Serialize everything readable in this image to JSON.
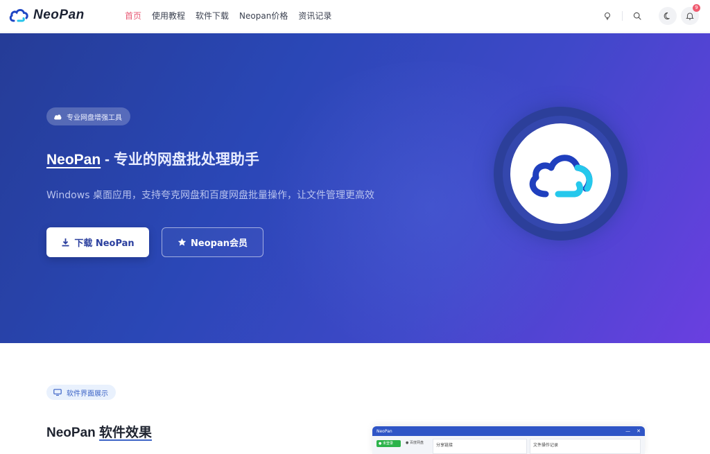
{
  "brand": {
    "name": "NeoPan"
  },
  "nav": {
    "items": [
      {
        "label": "首页",
        "active": true
      },
      {
        "label": "使用教程",
        "active": false
      },
      {
        "label": "软件下载",
        "active": false
      },
      {
        "label": "Neopan价格",
        "active": false
      },
      {
        "label": "资讯记录",
        "active": false
      }
    ],
    "notification_count": "9"
  },
  "hero": {
    "pill_text": "专业网盘增强工具",
    "title_brand": "NeoPan",
    "title_rest": " - 专业的网盘批处理助手",
    "subtitle": "Windows 桌面应用，支持夸克网盘和百度网盘批量操作，让文件管理更高效",
    "primary_button": "下载 NeoPan",
    "secondary_button": "Neopan会员"
  },
  "section": {
    "pill_text": "软件界面展示",
    "title_prefix": "NeoPan ",
    "title_emphasis": "软件效果"
  },
  "preview": {
    "window_title": "NeoPan",
    "green_tag": "● 未登录",
    "tab_label": "● 百度网盘",
    "panel_left": "分享链接",
    "panel_right": "文件操作记录"
  },
  "colors": {
    "accent_active": "#e85a76",
    "hero_start": "#253c97",
    "hero_end": "#6a3fe0",
    "primary_text": "#2b3f9e"
  }
}
